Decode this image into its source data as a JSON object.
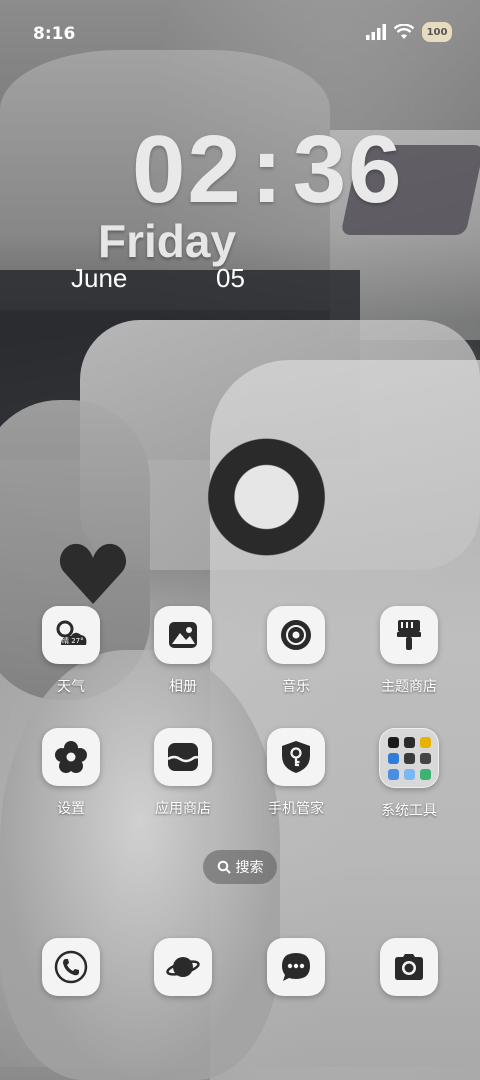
{
  "status_bar": {
    "time": "8:16",
    "signal_icon": "cellular-signal-icon",
    "wifi_icon": "wifi-icon",
    "battery_label": "100"
  },
  "clock_widget": {
    "hours": "02",
    "colon": ":",
    "minutes": "36",
    "day_of_week": "Friday",
    "month": "June",
    "day": "05"
  },
  "apps": [
    {
      "label": "天气",
      "icon": "weather-icon",
      "weather_text": "晴 27°"
    },
    {
      "label": "相册",
      "icon": "gallery-icon"
    },
    {
      "label": "音乐",
      "icon": "music-icon"
    },
    {
      "label": "主题商店",
      "icon": "theme-store-icon"
    },
    {
      "label": "设置",
      "icon": "settings-flower-icon"
    },
    {
      "label": "应用商店",
      "icon": "app-store-icon"
    },
    {
      "label": "手机管家",
      "icon": "phone-manager-shield-icon"
    },
    {
      "label": "系统工具",
      "icon": "folder-icon"
    }
  ],
  "search": {
    "label": "搜索",
    "icon": "search-icon"
  },
  "dock": [
    {
      "icon": "phone-icon"
    },
    {
      "icon": "browser-planet-icon"
    },
    {
      "icon": "messages-icon"
    },
    {
      "icon": "camera-icon"
    }
  ],
  "colors": {
    "icon_bg": "#f4f4f4",
    "glyph": "#2a2a2a",
    "battery": "#e8dcc0"
  }
}
